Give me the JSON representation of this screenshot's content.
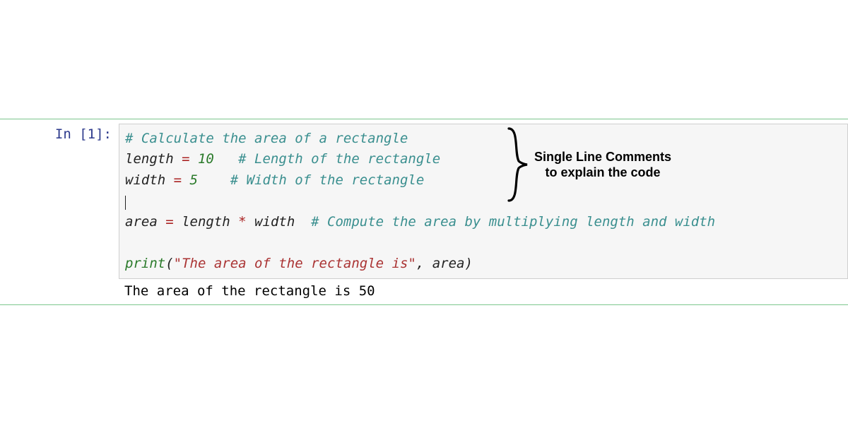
{
  "cell": {
    "prompt": "In [1]:",
    "code": {
      "l1_c1": "# Calculate the area of a rectangle",
      "l2_var": "length ",
      "l2_op": "=",
      "l2_num": " 10",
      "l2_cm": "   # Length of the rectangle",
      "l3_var": "width ",
      "l3_op": "=",
      "l3_num": " 5",
      "l3_cm": "    # Width of the rectangle",
      "l5_var1": "area ",
      "l5_op1": "=",
      "l5_var2": " length ",
      "l5_op2": "*",
      "l5_var3": " width  ",
      "l5_cm": "# Compute the area by multiplying length and width",
      "l7_func": "print",
      "l7_p1": "(",
      "l7_str": "\"The area of the rectangle is\"",
      "l7_comma": ",",
      "l7_arg": " area",
      "l7_p2": ")"
    },
    "output": "The area of the rectangle is 50"
  },
  "annotation": {
    "line1": "Single Line Comments",
    "line2": "to explain the code"
  }
}
